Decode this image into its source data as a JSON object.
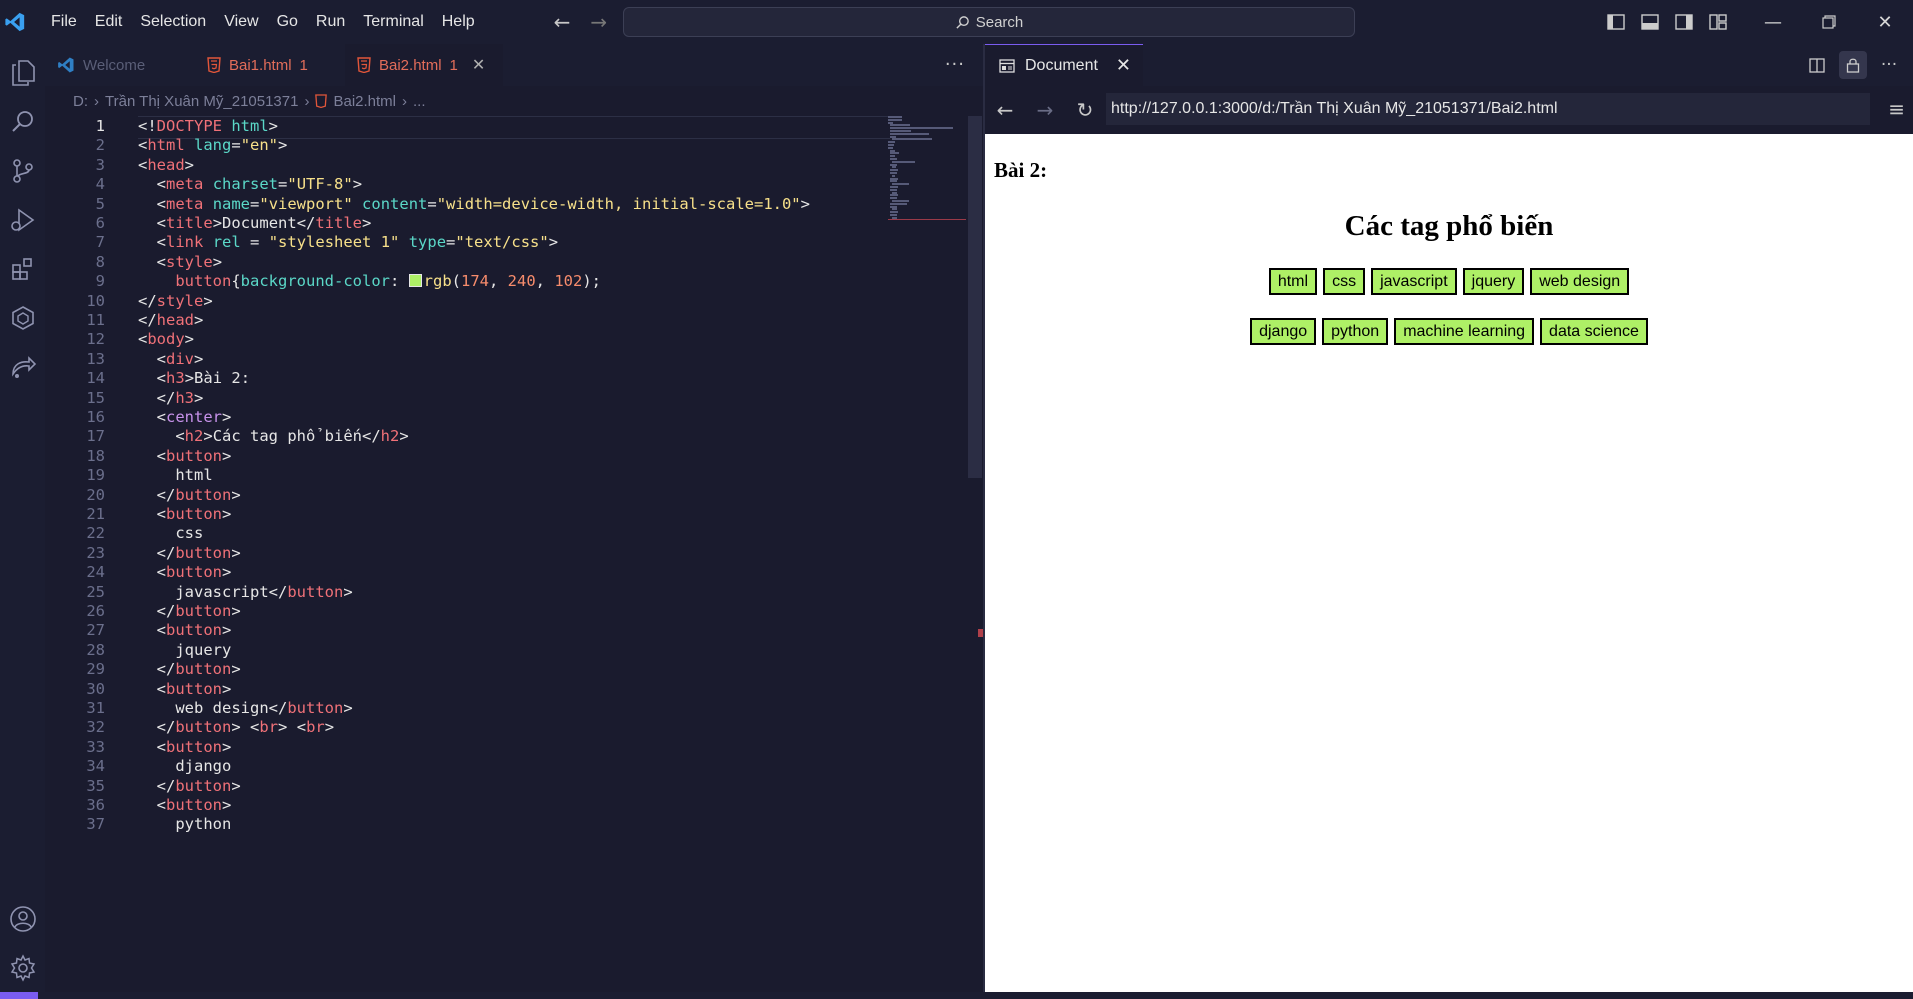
{
  "menu": [
    "File",
    "Edit",
    "Selection",
    "View",
    "Go",
    "Run",
    "Terminal",
    "Help"
  ],
  "search": {
    "label": "Search"
  },
  "editor_tabs": [
    {
      "label": "Welcome",
      "badge": ""
    },
    {
      "label": "Bai1.html",
      "badge": "1"
    },
    {
      "label": "Bai2.html",
      "badge": "1"
    }
  ],
  "breadcrumb": {
    "drive": "D:",
    "folder": "Trần Thị Xuân Mỹ_21051371",
    "file": "Bai2.html",
    "tail": "..."
  },
  "code": {
    "line_numbers": [
      "1",
      "2",
      "3",
      "4",
      "5",
      "6",
      "7",
      "8",
      "9",
      "10",
      "11",
      "12",
      "13",
      "14",
      "15",
      "16",
      "17",
      "18",
      "19",
      "20",
      "21",
      "22",
      "23",
      "24",
      "25",
      "26",
      "27",
      "28",
      "29",
      "30",
      "31",
      "32",
      "33",
      "34",
      "35",
      "36",
      "37"
    ],
    "lines": [
      "<!DOCTYPE html>",
      "<html lang=\"en\">",
      "<head>",
      "  <meta charset=\"UTF-8\">",
      "  <meta name=\"viewport\" content=\"width=device-width, initial-scale=1.0\">",
      "  <title>Document</title>",
      "  <link rel = \"stylesheet 1\" type=\"text/css\">",
      "  <style>",
      "    button{background-color: rgb(174, 240, 102);",
      "</style>",
      "</head>",
      "<body>",
      "  <div>",
      "  <h3>Bài 2:",
      "  </h3>",
      "  <center>",
      "    <h2>Các tag phổ biến</h2>",
      "  <button>",
      "    html",
      "  </button>",
      "  <button>",
      "    css",
      "  </button>",
      "  <button>",
      "    javascript</button>",
      "  </button>",
      "  <button>",
      "    jquery",
      "  </button>",
      "  <button>",
      "    web design</button>",
      "  </button> <br> <br>",
      "  <button>",
      "    django",
      "  </button>",
      "  <button>",
      "    python"
    ]
  },
  "preview": {
    "tab_title": "Document",
    "url": "http://127.0.0.1:3000/d:/Trần Thị Xuân Mỹ_21051371/Bai2.html",
    "h3": "Bài 2:",
    "h2": "Các tag phổ biến",
    "row1": [
      "html",
      "css",
      "javascript",
      "jquery",
      "web design"
    ],
    "row2": [
      "django",
      "python",
      "machine learning",
      "data science"
    ],
    "button_color": "#aef066"
  },
  "colors": {
    "accent": "#7a5cf0",
    "background": "#1a1b2e",
    "tag": "#f07178",
    "attr": "#5bd8c8",
    "string": "#f7e08a"
  }
}
